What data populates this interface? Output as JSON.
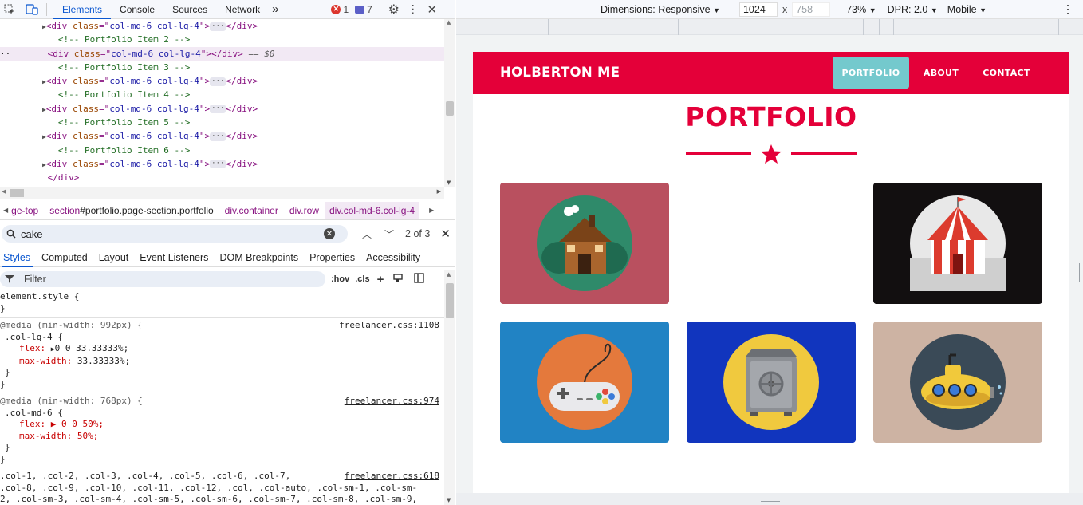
{
  "devtools": {
    "tabs": [
      "Elements",
      "Console",
      "Sources",
      "Network"
    ],
    "more_tabs": "»",
    "error_count": "1",
    "message_count": "7",
    "dom_lines": [
      {
        "type": "el",
        "text_class": "col-md-6 col-lg-4"
      },
      {
        "type": "comment",
        "text": "<!-- Portfolio Item 2 -->"
      },
      {
        "type": "el",
        "text_class": "col-md-6 col-lg-4",
        "selected": true,
        "suffix": "== $0"
      },
      {
        "type": "comment",
        "text": "<!-- Portfolio Item 3 -->"
      },
      {
        "type": "el",
        "text_class": "col-md-6 col-lg-4"
      },
      {
        "type": "comment",
        "text": "<!-- Portfolio Item 4 -->"
      },
      {
        "type": "el",
        "text_class": "col-md-6 col-lg-4"
      },
      {
        "type": "comment",
        "text": "<!-- Portfolio Item 5 -->"
      },
      {
        "type": "el",
        "text_class": "col-md-6 col-lg-4"
      },
      {
        "type": "comment",
        "text": "<!-- Portfolio Item 6 -->"
      },
      {
        "type": "el",
        "text_class": "col-md-6 col-lg-4"
      },
      {
        "type": "close",
        "text": "</div>"
      }
    ],
    "breadcrumbs": [
      {
        "tag": "ge-top",
        "sub": ""
      },
      {
        "tag": "section",
        "sub": "#portfolio.page-section.portfolio"
      },
      {
        "tag": "div",
        "sub": ".container"
      },
      {
        "tag": "div",
        "sub": ".row"
      },
      {
        "tag": "div",
        "sub": ".col-md-6.col-lg-4"
      }
    ],
    "search": {
      "value": "cake",
      "count": "2 of 3"
    },
    "style_tabs": [
      "Styles",
      "Computed",
      "Layout",
      "Event Listeners",
      "DOM Breakpoints",
      "Properties",
      "Accessibility"
    ],
    "filter_placeholder": "Filter",
    "hov_label": ":hov",
    "cls_label": ".cls",
    "styles": {
      "element_style": "element.style {",
      "close_brace": "}",
      "rule1_media": "@media (min-width: 992px) {",
      "rule1_src": "freelancer.css:1108",
      "rule1_selector": ".col-lg-4 {",
      "rule1_flex_prop": "flex:",
      "rule1_flex_val": "0 0 33.33333%;",
      "rule1_maxw_prop": "max-width:",
      "rule1_maxw_val": "33.33333%;",
      "rule2_media": "@media (min-width: 768px) {",
      "rule2_src": "freelancer.css:974",
      "rule2_selector": ".col-md-6 {",
      "rule2_flex": "flex: ▶ 0 0 50%;",
      "rule2_maxw": "max-width: 50%;",
      "rule3_src": "freelancer.css:618",
      "rule3_line1": ".col-1, .col-2, .col-3, .col-4, .col-5, .col-6, .col-7,",
      "rule3_line2": ".col-8, .col-9, .col-10, .col-11, .col-12, .col, .col-auto, .col-sm-1, .col-sm-",
      "rule3_line3": "2, .col-sm-3, .col-sm-4, .col-sm-5, .col-sm-6, .col-sm-7, .col-sm-8, .col-sm-9,"
    }
  },
  "device": {
    "dimensions_label": "Dimensions: Responsive",
    "width": "1024",
    "times": "x",
    "height": "758",
    "zoom": "73%",
    "dpr": "DPR: 2.0",
    "mode": "Mobile"
  },
  "site": {
    "brand": "HOLBERTON ME",
    "nav": [
      "PORTFOLIO",
      "ABOUT",
      "CONTACT"
    ],
    "title": "PORTFOLIO",
    "cards": [
      {
        "icon": "cabin-icon",
        "bg": "#b9505f",
        "circle": "#2f8a6a"
      },
      {
        "icon": "circus-tent-icon",
        "bg": "#120f10",
        "circle": "#e8e8e8"
      },
      {
        "icon": "game-controller-icon",
        "bg": "#2183c4",
        "circle": "#e4793c"
      },
      {
        "icon": "safe-icon",
        "bg": "#1135be",
        "circle": "#f0c93e"
      },
      {
        "icon": "submarine-icon",
        "bg": "#cdb3a3",
        "circle": "#3a4a57"
      }
    ],
    "colors": {
      "brand": "#e40039",
      "active_nav": "#74c9cd"
    }
  }
}
